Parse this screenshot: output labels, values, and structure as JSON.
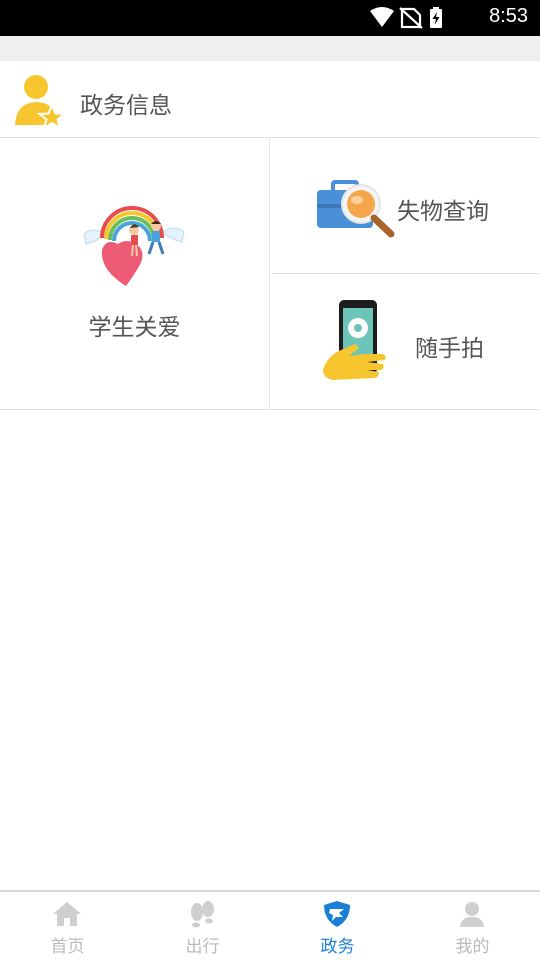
{
  "status_bar": {
    "time": "8:53",
    "icons": [
      "wifi-icon",
      "no-sim-icon",
      "battery-charging-icon"
    ]
  },
  "section": {
    "title": "政务信息",
    "icon": "user-star-icon"
  },
  "tiles": {
    "student_care": {
      "label": "学生关爱",
      "icon": "heart-rainbow-icon"
    },
    "lost_found": {
      "label": "失物查询",
      "icon": "briefcase-magnifier-icon"
    },
    "snapshot": {
      "label": "随手拍",
      "icon": "phone-camera-hand-icon"
    }
  },
  "bottom_nav": {
    "items": [
      {
        "label": "首页",
        "icon": "home-icon",
        "active": false
      },
      {
        "label": "出行",
        "icon": "footprints-icon",
        "active": false
      },
      {
        "label": "政务",
        "icon": "shield-icon",
        "active": true
      },
      {
        "label": "我的",
        "icon": "person-icon",
        "active": false
      }
    ]
  },
  "colors": {
    "accent": "#1a7ed6",
    "inactive": "#bbbbbb",
    "icon_yellow": "#f7c52d"
  }
}
